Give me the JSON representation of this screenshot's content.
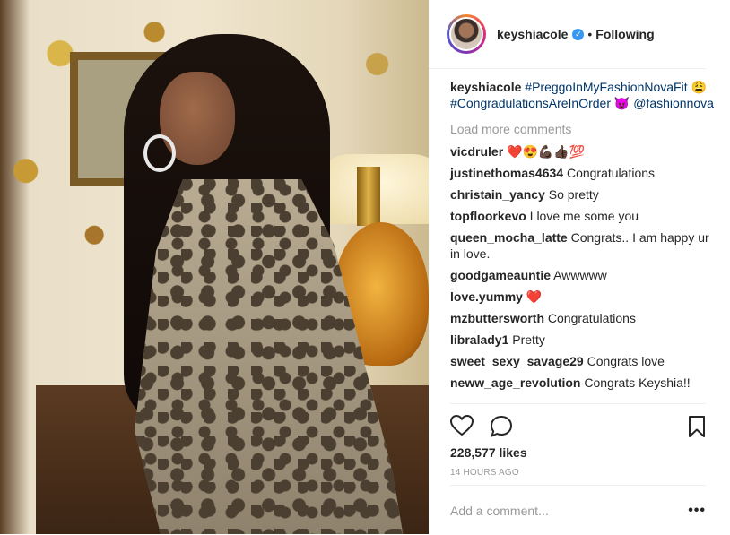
{
  "header": {
    "username": "keyshiacole",
    "separator": "•",
    "follow_state": "Following"
  },
  "caption": {
    "username": "keyshiacole",
    "hashtag1": "#PreggoInMyFashionNovaFit",
    "emoji1": "😩",
    "hashtag2": "#CongradulationsAreInOrder",
    "emoji2": "😈",
    "mention": "@fashionnova"
  },
  "load_more": "Load more comments",
  "comments": [
    {
      "user": "vicdruler",
      "text": "❤️😍💪🏿👍🏿💯"
    },
    {
      "user": "justinethomas4634",
      "text": "Congratulations"
    },
    {
      "user": "christain_yancy",
      "text": "So pretty"
    },
    {
      "user": "topfloorkevo",
      "text": "I love me some you"
    },
    {
      "user": "queen_mocha_latte",
      "text": "Congrats.. I am happy ur in love."
    },
    {
      "user": "goodgameauntie",
      "text": "Awwwww"
    },
    {
      "user": "love.yummy",
      "text": "❤️"
    },
    {
      "user": "mzbuttersworth",
      "text": "Congratulations"
    },
    {
      "user": "libralady1",
      "text": "Pretty"
    },
    {
      "user": "sweet_sexy_savage29",
      "text": "Congrats love"
    },
    {
      "user": "neww_age_revolution",
      "text": "Congrats Keyshia!!"
    }
  ],
  "likes": "228,577 likes",
  "time_ago": "14 HOURS AGO",
  "add_comment": {
    "placeholder": "Add a comment..."
  },
  "more_label": "•••",
  "icons": {
    "like": "heart-outline-icon",
    "comment": "speech-bubble-icon",
    "save": "bookmark-outline-icon",
    "verified": "verified-badge-icon"
  },
  "colors": {
    "link": "#003569",
    "verified": "#3897f0",
    "muted": "#999999"
  }
}
